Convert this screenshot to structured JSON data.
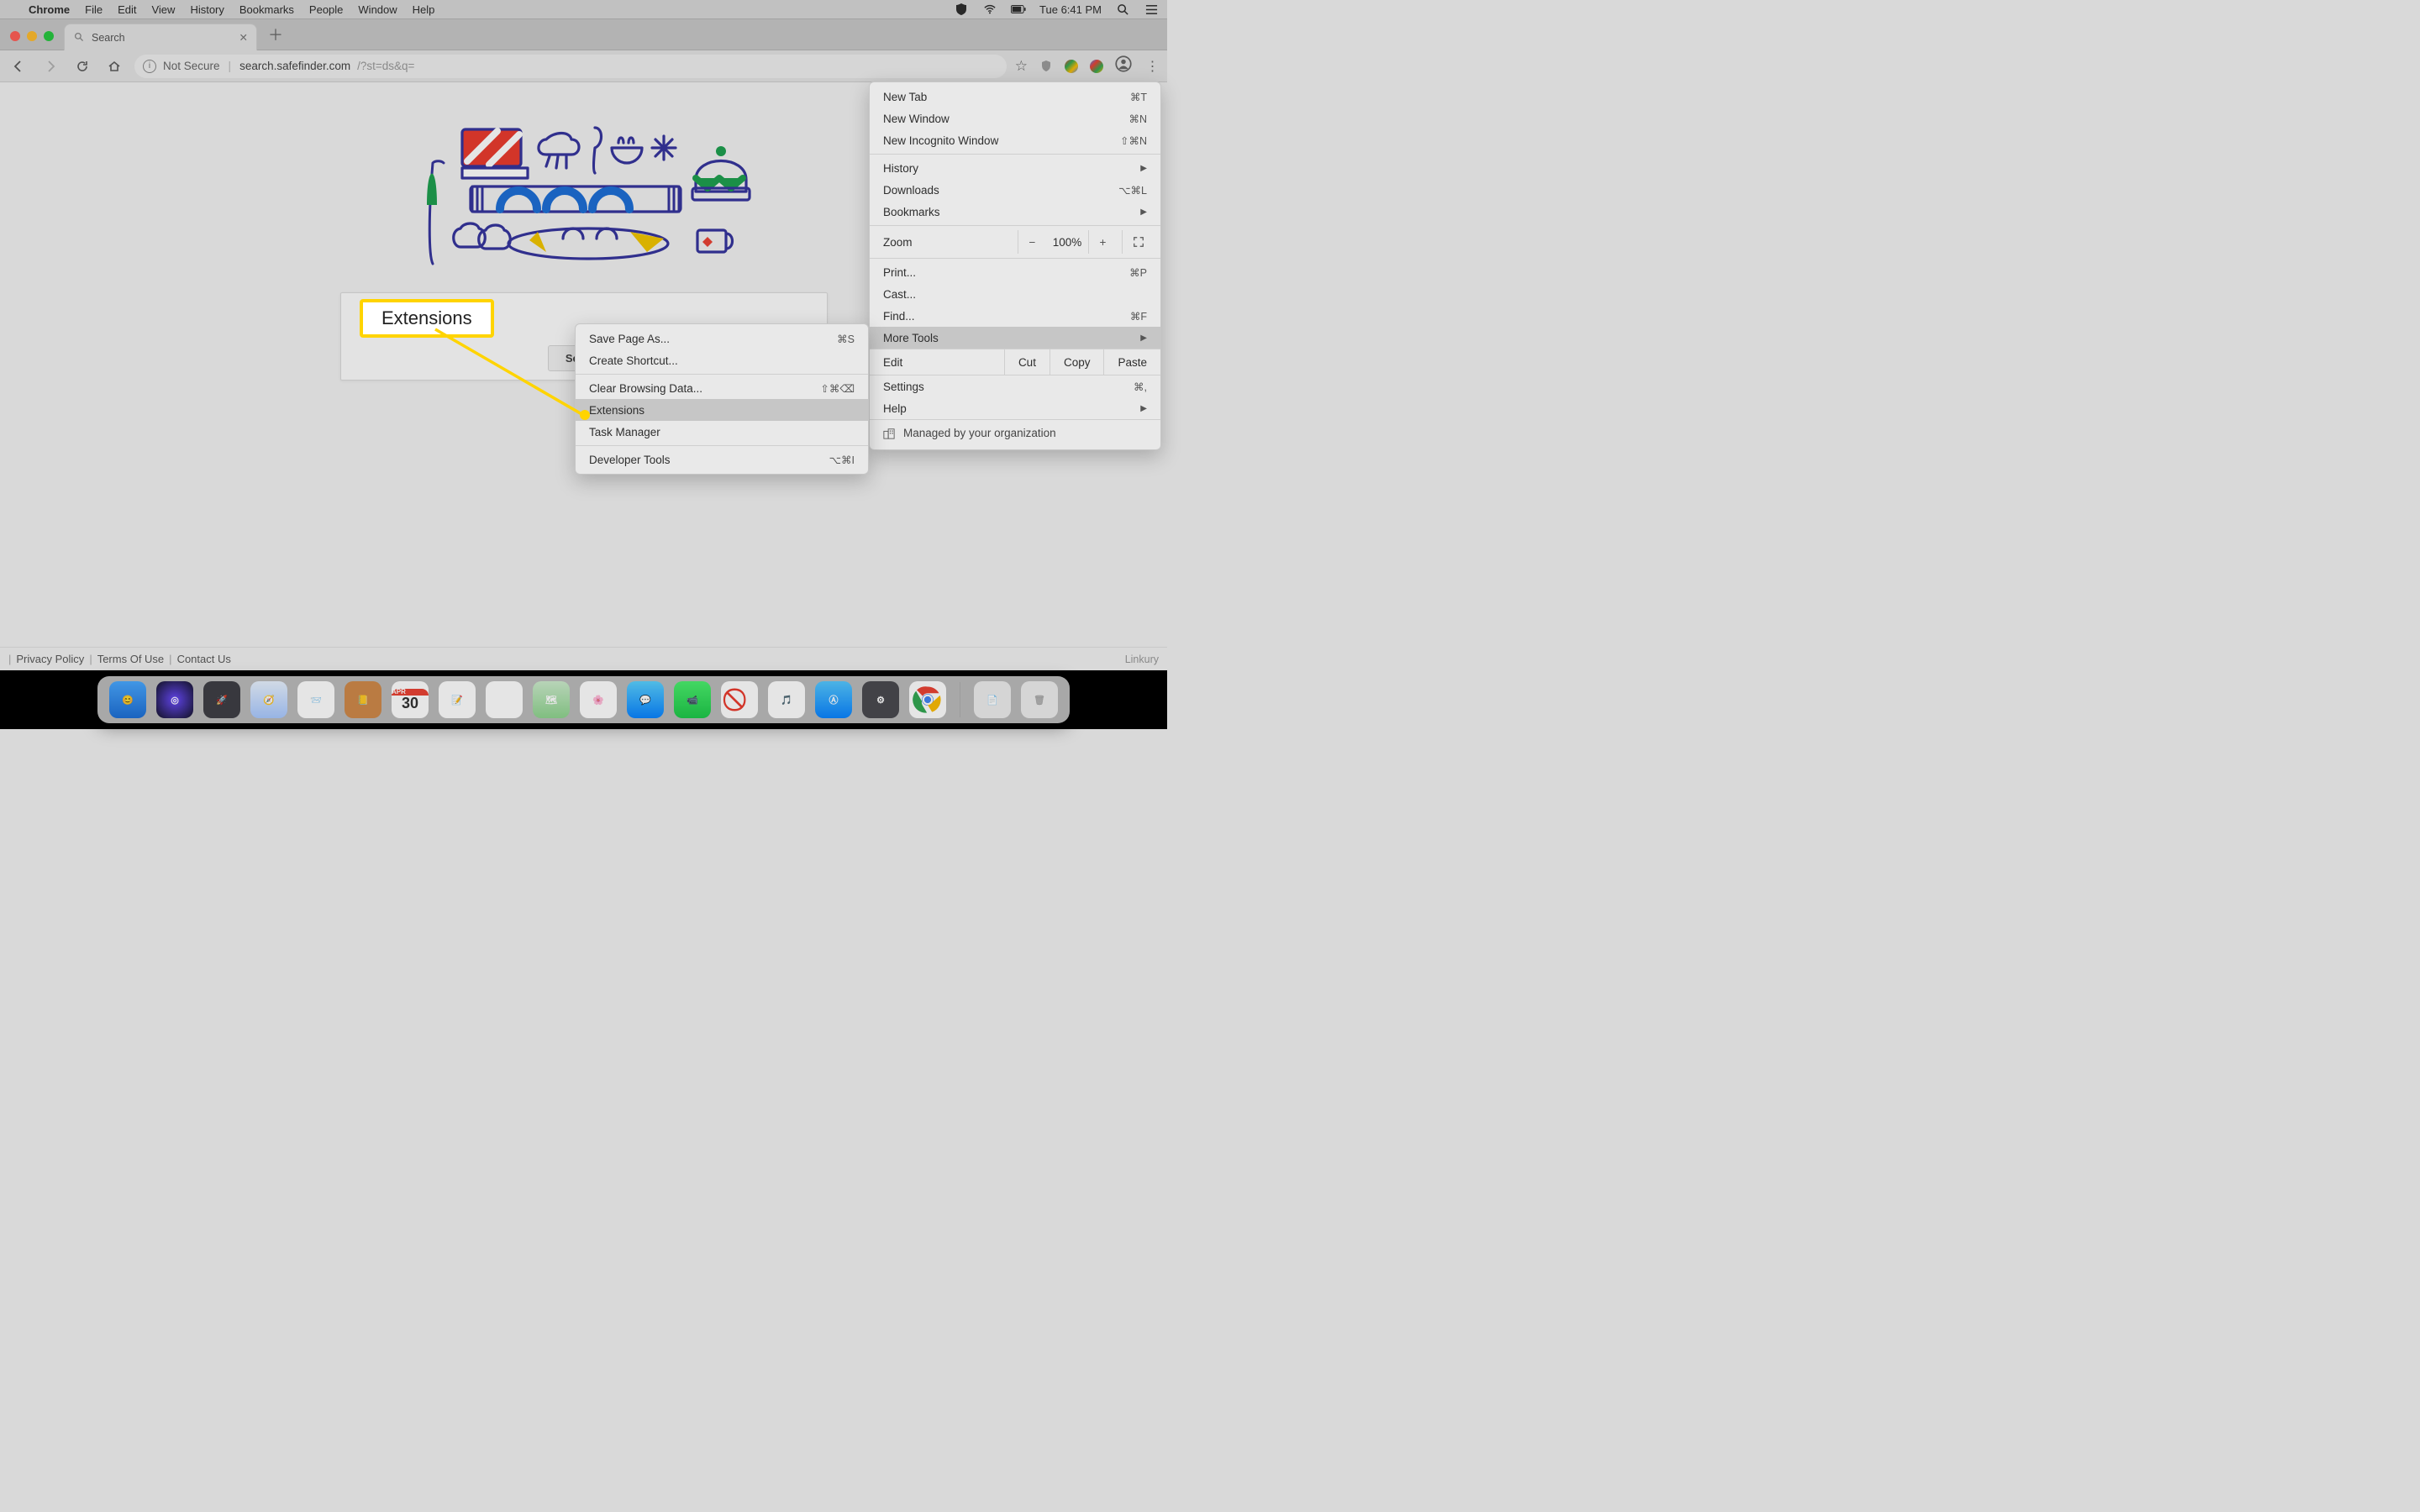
{
  "menubar": {
    "app": "Chrome",
    "items": [
      "File",
      "Edit",
      "View",
      "History",
      "Bookmarks",
      "People",
      "Window",
      "Help"
    ],
    "clock": "Tue 6:41 PM"
  },
  "tab": {
    "title": "Search"
  },
  "toolbar": {
    "notsecure": "Not Secure",
    "host": "search.safefinder.com",
    "path": "/?st=ds&q="
  },
  "page": {
    "search_button": "Search",
    "privacy": "Privacy Policy",
    "terms": "Terms Of Use",
    "contact": "Contact Us",
    "brand": "Linkury"
  },
  "main_menu": {
    "new_tab": "New Tab",
    "sc_new_tab": "⌘T",
    "new_window": "New Window",
    "sc_new_window": "⌘N",
    "new_incognito": "New Incognito Window",
    "sc_new_incognito": "⇧⌘N",
    "history": "History",
    "downloads": "Downloads",
    "sc_downloads": "⌥⌘L",
    "bookmarks": "Bookmarks",
    "zoom": "Zoom",
    "zoom_pct": "100%",
    "print": "Print...",
    "sc_print": "⌘P",
    "cast": "Cast...",
    "find": "Find...",
    "sc_find": "⌘F",
    "more_tools": "More Tools",
    "edit": "Edit",
    "cut": "Cut",
    "copy": "Copy",
    "paste": "Paste",
    "settings": "Settings",
    "sc_settings": "⌘,",
    "help": "Help",
    "managed": "Managed by your organization"
  },
  "sub_menu": {
    "save_page": "Save Page As...",
    "sc_save_page": "⌘S",
    "create_shortcut": "Create Shortcut...",
    "clear_data": "Clear Browsing Data...",
    "sc_clear_data": "⇧⌘⌫",
    "extensions": "Extensions",
    "task_manager": "Task Manager",
    "dev_tools": "Developer Tools",
    "sc_dev_tools": "⌥⌘I"
  },
  "callout": {
    "label": "Extensions"
  }
}
